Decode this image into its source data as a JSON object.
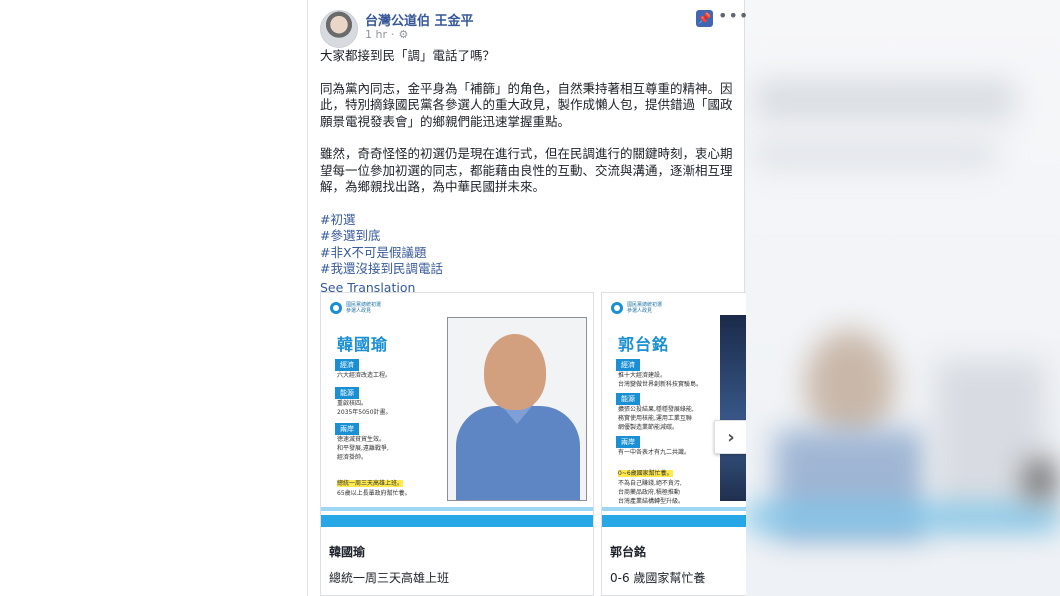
{
  "post": {
    "author": "台灣公道伯 王金平",
    "time": "1 hr",
    "dot": "·",
    "text": {
      "p1": "大家都接到民「調」電話了嗎？",
      "p2": "同為黨內同志，金平身為「補篩」的角色，自然秉持著相互尊重的精神。因此，特別摘錄國民黨各參選人的重大政見，製作成懶人包，提供錯過「國政願景電視發表會」的鄉親們能迅速掌握重點。",
      "p3": "雖然，奇奇怪怪的初選仍是現在進行式，但在民調進行的關鍵時刻，衷心期望每一位參加初選的同志，都能藉由良性的互動、交流與溝通，逐漸相互理解，為鄉親找出路，為中華民國拼未來。",
      "hashtags": [
        "#初選",
        "#參選到底",
        "#非X不可是假議題",
        "#我還沒接到民調電話"
      ],
      "see_translation": "See Translation"
    },
    "icons": {
      "gear": "gear-icon",
      "pin": "pin-icon",
      "more": "more-icon",
      "next": "chevron-right-icon"
    }
  },
  "cards": [
    {
      "logo_line1": "國民黨總統初選",
      "logo_line2": "參選人政見",
      "name": "韓國瑜",
      "sections": [
        {
          "label": "經濟",
          "items": [
            "六大經濟改造工程。"
          ]
        },
        {
          "label": "能源",
          "items": [
            "重啟核四。",
            "2035年5050計畫。"
          ]
        },
        {
          "label": "兩岸",
          "items": [
            "徳速滅貧貿生效。",
            "和平發展,遠離戰爭,",
            "經濟掛帥。"
          ]
        }
      ],
      "highlight": "總統一周三天高雄上班。",
      "extra": "65歲以上長輩政府幫忙養。",
      "title": "韓國瑜",
      "description": "總統一周三天高雄上班"
    },
    {
      "logo_line1": "國民黨總統初選",
      "logo_line2": "參選人政見",
      "name": "郭台銘",
      "sections": [
        {
          "label": "經濟",
          "items": [
            "推十大經濟建設。",
            "台灣變做世界創新科技實驗島。"
          ]
        },
        {
          "label": "能源",
          "items": [
            "擴張公投結果,穩穩發展綠能,",
            "務實使用核能,運用工業互聯",
            "網優製造業節能減碳。"
          ]
        },
        {
          "label": "兩岸",
          "items": [
            "有一中各表才有九二共識。"
          ]
        }
      ],
      "highlight": "0~6歲國家幫忙養。",
      "extra_lines": [
        "不為自己賺錢,絕不貪污,",
        "台商藥品政府,積極推動",
        "台灣產業結構轉型升級。"
      ],
      "title": "郭台銘",
      "description": "0-6 歲國家幫忙養"
    }
  ]
}
